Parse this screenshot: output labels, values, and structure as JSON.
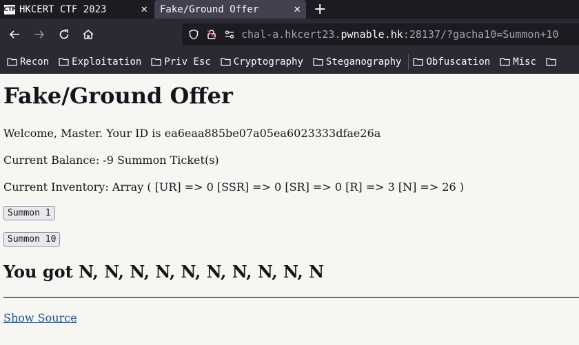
{
  "browser": {
    "tabs": [
      {
        "title": "HKCERT CTF 2023",
        "favicon_text": "CTF",
        "active": false
      },
      {
        "title": "Fake/Ground Offer",
        "active": true
      }
    ],
    "url": {
      "prefix": "chal-a.hkcert23.",
      "domain": "pwnable.hk",
      "suffix": ":28137/?gacha10=Summon+10"
    },
    "bookmarks": [
      "Recon",
      "Exploitation",
      "Priv Esc",
      "Cryptography",
      "Steganography",
      "Obfuscation",
      "Misc",
      ""
    ]
  },
  "page": {
    "title": "Fake/Ground Offer",
    "welcome": "Welcome, Master. Your ID is ea6eaa885be07a05ea6023333dfae26a",
    "balance": "Current Balance: -9 Summon Ticket(s)",
    "inventory": "Current Inventory: Array ( [UR] => 0 [SSR] => 0 [SR] => 0 [R] => 3 [N] => 26 )",
    "summon1_label": "Summon 1",
    "summon10_label": "Summon 10",
    "result": "You got N, N, N, N, N, N, N, N, N, N",
    "show_source": "Show Source"
  },
  "colors": {
    "page_bg": "#f7f6f3",
    "link": "#1f4f8c",
    "chrome_dark": "#1c1b22",
    "chrome": "#2b2a33"
  }
}
